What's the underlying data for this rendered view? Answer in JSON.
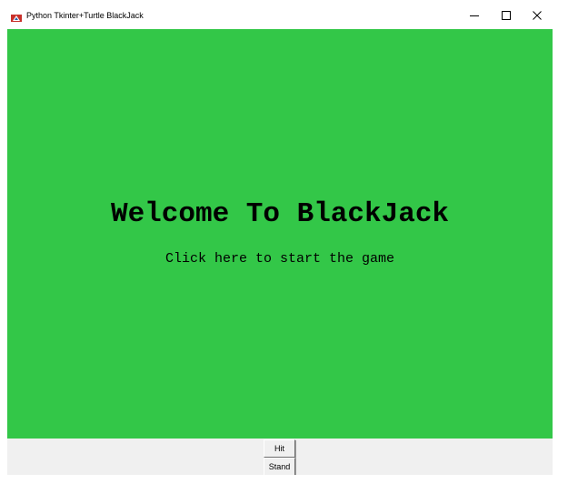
{
  "window": {
    "title": "Python Tkinter+Turtle BlackJack",
    "icon": "feather-tk-icon",
    "controls": {
      "minimize_icon": "minimize-icon",
      "maximize_icon": "maximize-icon",
      "close_icon": "close-icon"
    }
  },
  "canvas": {
    "background_color": "#33c748",
    "title": "Welcome To BlackJack",
    "start_prompt": "Click here to start the game"
  },
  "controls": {
    "hit_label": "Hit",
    "stand_label": "Stand"
  }
}
